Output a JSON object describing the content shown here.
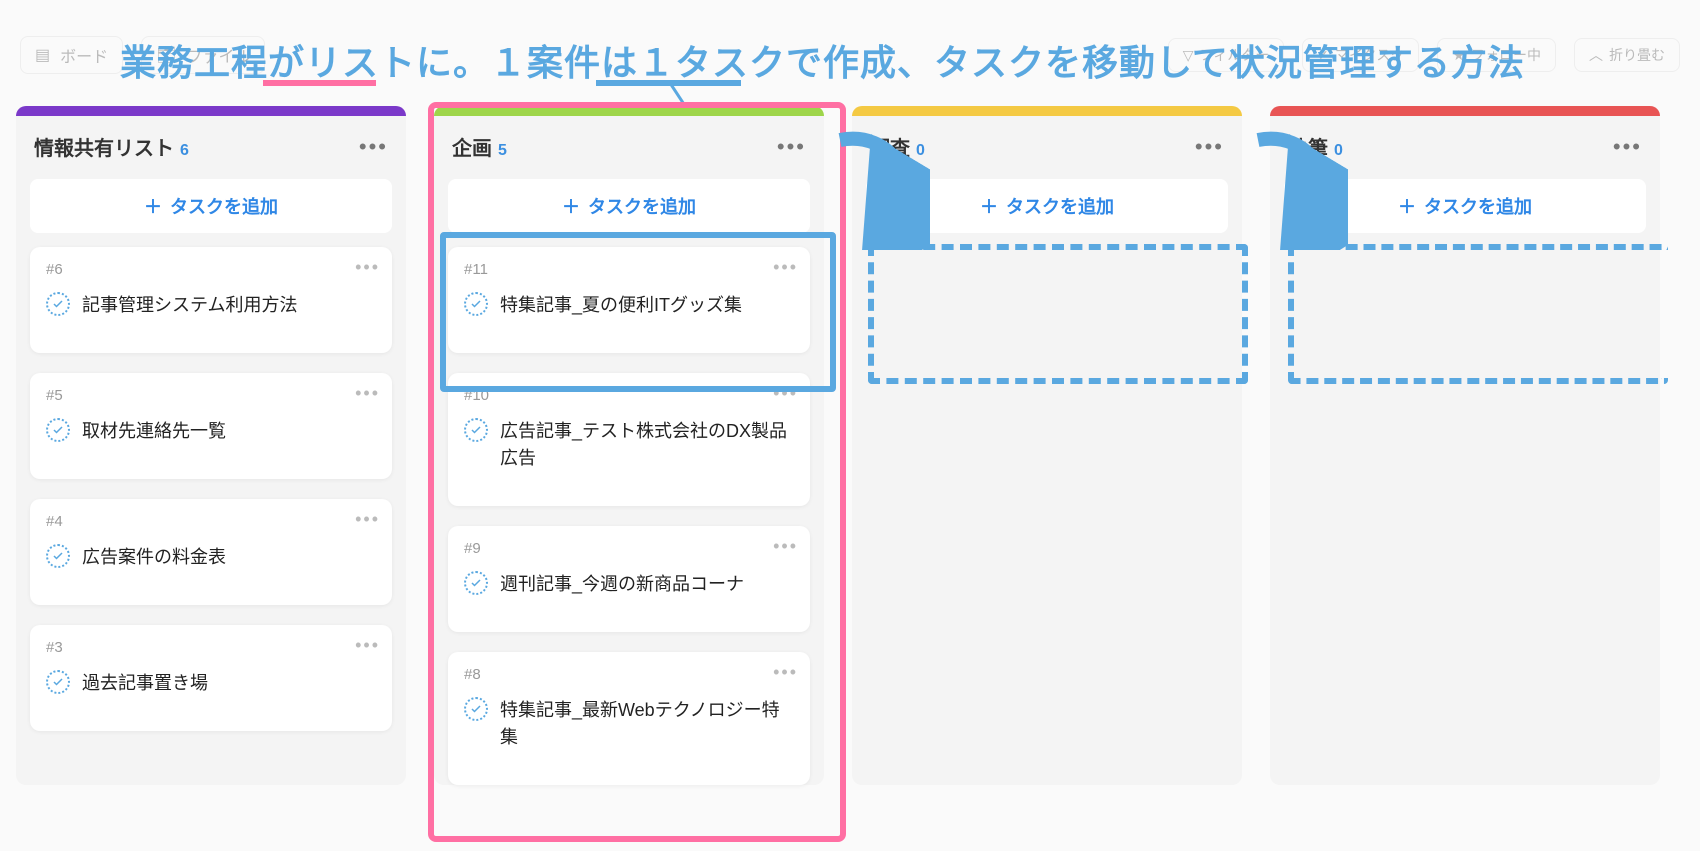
{
  "overlay": {
    "title": "業務工程がリストに。１案件は１タスクで作成、タスクを移動して状況管理する方法"
  },
  "toolbar": {
    "view_board": "ボード",
    "view_file": "ファイル",
    "filter": "フィルター",
    "mytask": "マイタスク",
    "follow": "フォロー中",
    "collapse": "折り畳む"
  },
  "common": {
    "add_task": "タスクを追加"
  },
  "columns": [
    {
      "title": "情報共有リスト",
      "count": 6,
      "color": "c-purple",
      "cards": [
        {
          "id": "#6",
          "title": "記事管理システム利用方法"
        },
        {
          "id": "#5",
          "title": "取材先連絡先一覧"
        },
        {
          "id": "#4",
          "title": "広告案件の料金表"
        },
        {
          "id": "#3",
          "title": "過去記事置き場"
        }
      ]
    },
    {
      "title": "企画",
      "count": 5,
      "color": "c-green",
      "cards": [
        {
          "id": "#11",
          "title": "特集記事_夏の便利ITグッズ集"
        },
        {
          "id": "#10",
          "title": "広告記事_テスト株式会社のDX製品広告"
        },
        {
          "id": "#9",
          "title": "週刊記事_今週の新商品コーナ"
        },
        {
          "id": "#8",
          "title": "特集記事_最新Webテクノロジー特集"
        }
      ]
    },
    {
      "title": "調査",
      "count": 0,
      "color": "c-yellow",
      "cards": []
    },
    {
      "title": "執筆",
      "count": 0,
      "color": "c-red",
      "cards": []
    }
  ]
}
